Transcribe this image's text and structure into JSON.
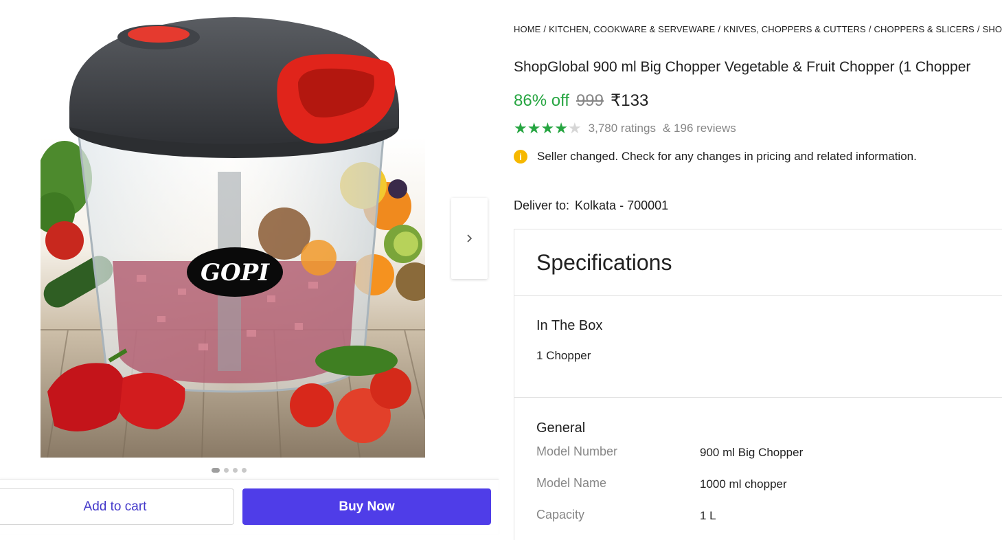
{
  "breadcrumb": [
    "HOME",
    "KITCHEN, COOKWARE & SERVEWARE",
    "KNIVES, CHOPPERS & CUTTERS",
    "CHOPPERS & SLICERS",
    "SHOP"
  ],
  "product": {
    "title": "ShopGlobal 900 ml Big Chopper Vegetable & Fruit Chopper (1 Chopper",
    "image_brand_text": "GOPI",
    "discount": "86% off",
    "mrp": "999",
    "price": "₹133",
    "rating_stars": 4,
    "rating_max": 5,
    "ratings_count": "3,780 ratings",
    "reviews_count": "& 196 reviews"
  },
  "notice": {
    "icon": "info-icon",
    "text": "Seller changed. Check for any changes in pricing and related information."
  },
  "delivery": {
    "label": "Deliver to:",
    "location": "Kolkata - 700001"
  },
  "gallery": {
    "dots_total": 4,
    "active_dot": 0
  },
  "actions": {
    "add_to_cart": "Add to cart",
    "buy_now": "Buy Now"
  },
  "specifications": {
    "heading": "Specifications",
    "in_the_box": {
      "title": "In The Box",
      "value": "1 Chopper"
    },
    "general": {
      "title": "General",
      "rows": [
        {
          "key": "Model Number",
          "value": "900 ml Big Chopper"
        },
        {
          "key": "Model Name",
          "value": "1000 ml chopper"
        },
        {
          "key": "Capacity",
          "value": "1 L"
        }
      ]
    }
  },
  "colors": {
    "accent": "#4f3de8",
    "discount_green": "#26a541",
    "star_green": "#26a541",
    "muted": "#878787"
  }
}
